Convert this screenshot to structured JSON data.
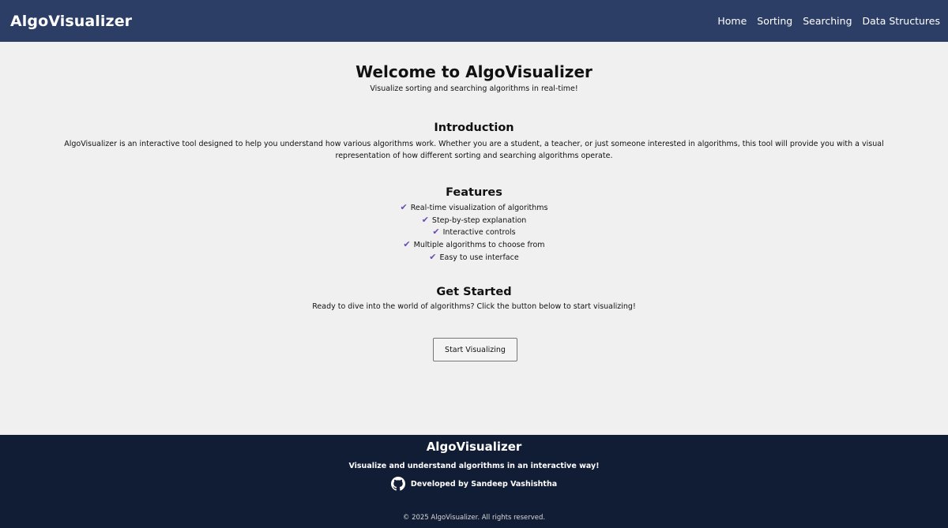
{
  "header": {
    "brand": "AlgoVisualizer",
    "nav": [
      "Home",
      "Sorting",
      "Searching",
      "Data Structures"
    ]
  },
  "hero": {
    "title": "Welcome to AlgoVisualizer",
    "subtitle": "Visualize sorting and searching algorithms in real-time!"
  },
  "intro": {
    "title": "Introduction",
    "text": "AlgoVisualizer is an interactive tool designed to help you understand how various algorithms work. Whether you are a student, a teacher, or just someone interested in algorithms, this tool will provide you with a visual representation of how different sorting and searching algorithms operate."
  },
  "features": {
    "title": "Features",
    "icon": "check-icon",
    "items": [
      "Real-time visualization of algorithms",
      "Step-by-step explanation",
      "Interactive controls",
      "Multiple algorithms to choose from",
      "Easy to use interface"
    ]
  },
  "get_started": {
    "title": "Get Started",
    "text": "Ready to dive into the world of algorithms? Click the button below to start visualizing!",
    "button_label": "Start Visualizing"
  },
  "footer": {
    "title": "AlgoVisualizer",
    "tagline": "Visualize and understand algorithms in an interactive way!",
    "developer": "Developed by Sandeep Vashishtha",
    "developer_icon": "github-icon",
    "copyright": "© 2025 AlgoVisualizer. All rights reserved."
  },
  "colors": {
    "header_bg": "#2c3e66",
    "footer_bg": "#111d35",
    "page_bg": "#f0f0f0",
    "check_accent": "#6b4bb3"
  }
}
